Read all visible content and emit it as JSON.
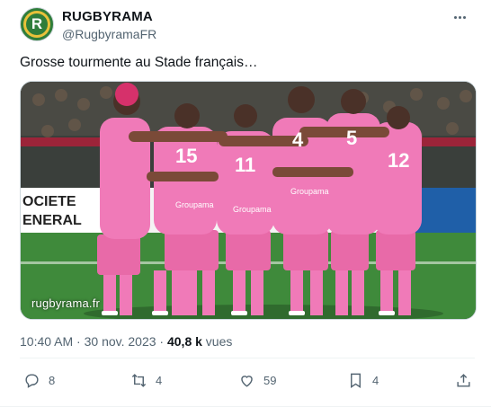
{
  "account": {
    "name": "RUGBYRAMA",
    "handle": "@RugbyramaFR",
    "avatar_letter": "R",
    "avatar_icon": "rugbyrama-logo"
  },
  "tweet": {
    "text": "Grosse tourmente au Stade français…",
    "media_watermark": "rugbyrama.fr",
    "time": "10:40 AM",
    "separator": " · ",
    "date": "30 nov. 2023",
    "views_count": "40,8 k",
    "views_label": " vues"
  },
  "actions": {
    "reply_count": "8",
    "retweet_count": "4",
    "like_count": "59",
    "bookmark_count": "4",
    "reply_icon": "reply-icon",
    "retweet_icon": "retweet-icon",
    "like_icon": "heart-icon",
    "bookmark_icon": "bookmark-icon",
    "share_icon": "share-icon"
  },
  "photo": {
    "ad_board_text_1": "OCIETE",
    "ad_board_text_2": "ENERAL",
    "jersey_numbers": [
      "15",
      "11",
      "4",
      "5",
      "12"
    ],
    "sponsor": "Groupama",
    "jersey_color": "#f07ab8",
    "pitch_color": "#3f8a3b"
  }
}
